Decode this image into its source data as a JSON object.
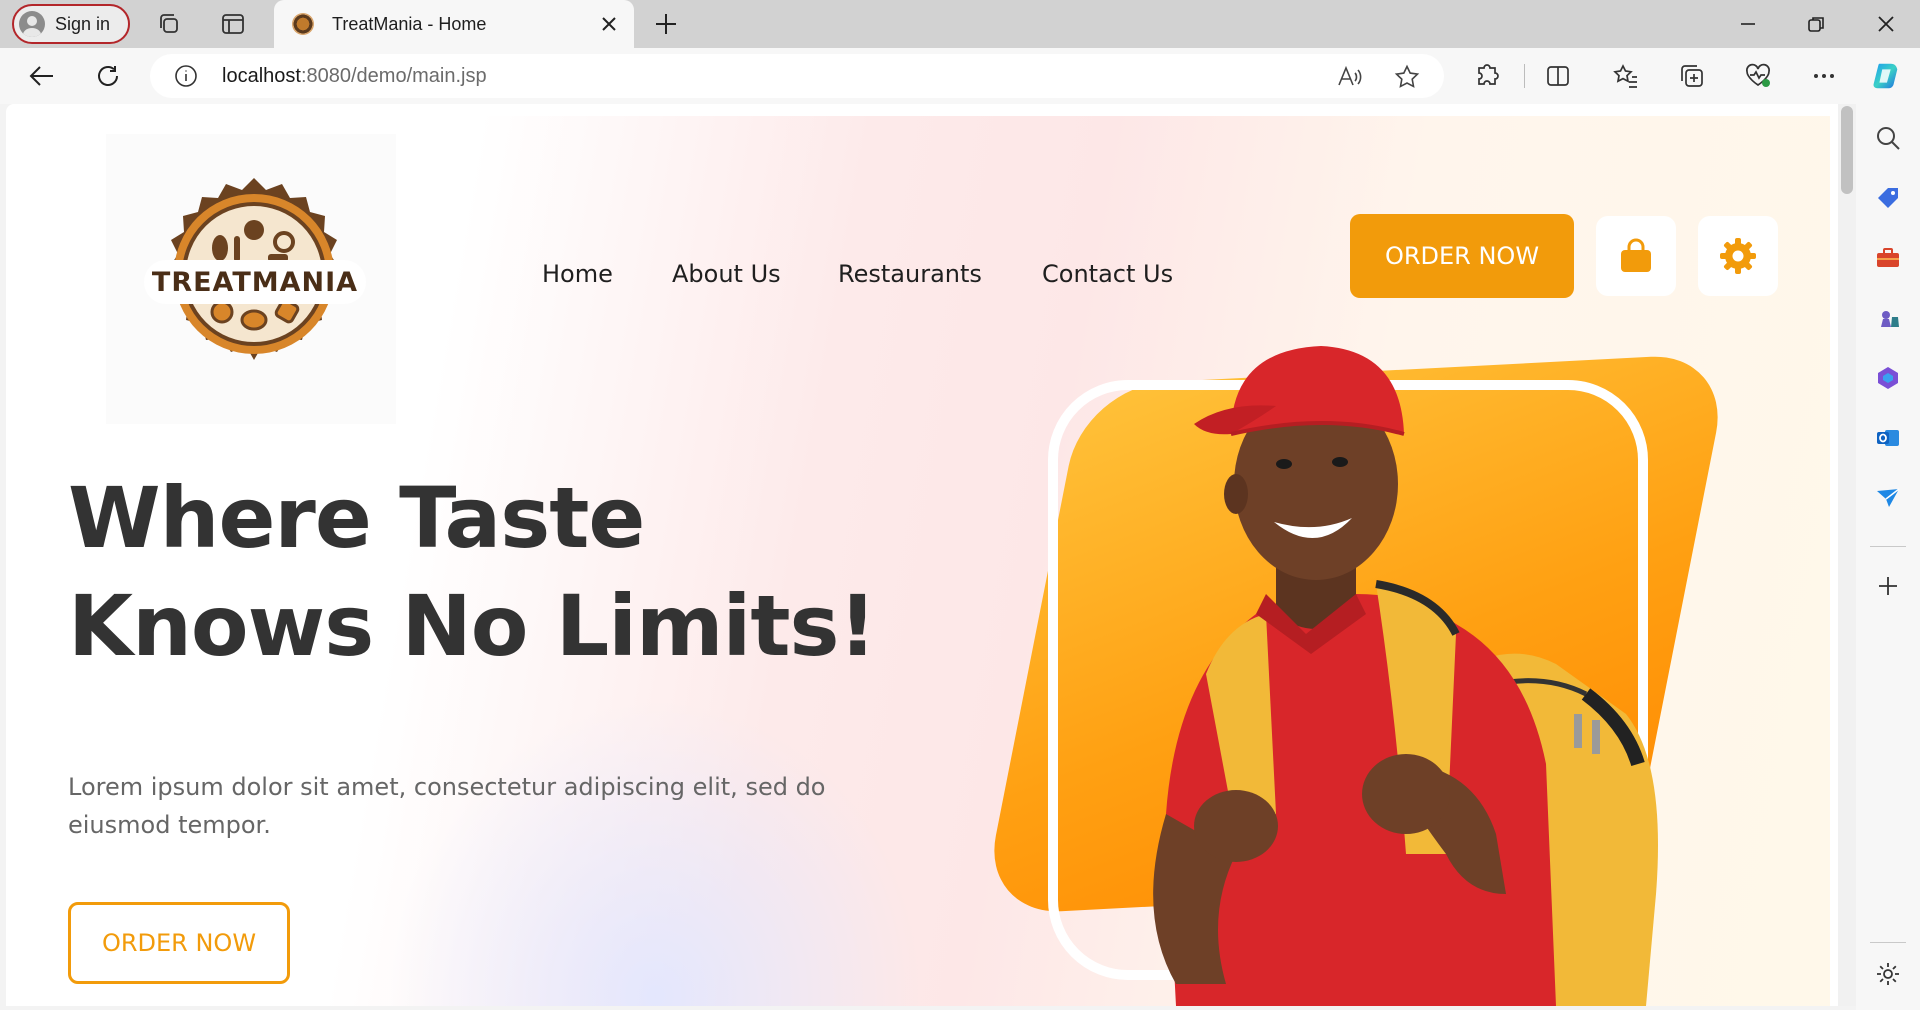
{
  "browser": {
    "sign_in_label": "Sign in",
    "tab_title": "TreatMania - Home",
    "url_host": "localhost",
    "url_path": ":8080/demo/main.jsp"
  },
  "site": {
    "logo_text": "TREATMANIA",
    "nav": [
      {
        "label": "Home"
      },
      {
        "label": "About Us"
      },
      {
        "label": "Restaurants"
      },
      {
        "label": "Contact Us"
      }
    ],
    "order_button_top": "ORDER NOW",
    "hero": {
      "headline_line1": "Where Taste",
      "headline_line2": "Knows No Limits!",
      "lead": "Lorem ipsum dolor sit amet, consectetur adipiscing elit, sed do eiusmod tempor.",
      "order_button": "ORDER NOW"
    }
  },
  "colors": {
    "accent": "#f29b0b",
    "headline": "#333333",
    "shirt": "#d8262a",
    "backpack": "#f4be45"
  }
}
